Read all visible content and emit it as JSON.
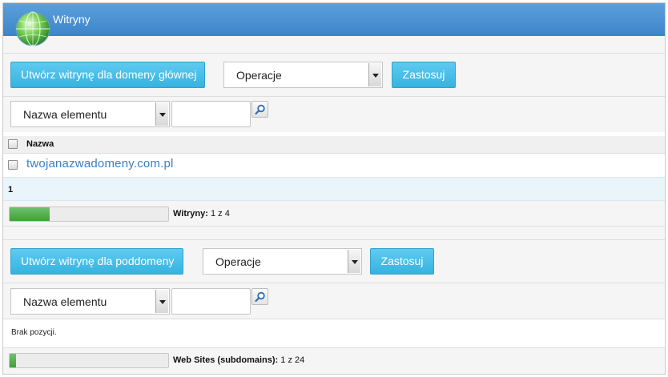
{
  "header": {
    "title": "Witryny",
    "icon": "globe-icon"
  },
  "domains_section": {
    "create_button": "Utwórz witrynę dla domeny głównej",
    "operations_select": "Operacje",
    "apply_button": "Zastosuj",
    "filter_select": "Nazwa elementu",
    "filter_value": "",
    "table": {
      "column_name": "Nazwa",
      "rows": [
        {
          "name": "twojanazwadomeny.com.pl"
        }
      ]
    },
    "pager": {
      "current_page": "1"
    },
    "usage": {
      "label": "Witryny:",
      "value": "1 z 4",
      "fraction": 0.25
    }
  },
  "subdomains_section": {
    "create_button": "Utwórz witrynę dla poddomeny",
    "operations_select": "Operacje",
    "apply_button": "Zastosuj",
    "filter_select": "Nazwa elementu",
    "filter_value": "",
    "empty_text": "Brak pozycji.",
    "usage": {
      "label": "Web Sites (subdomains):",
      "value": "1 z 24",
      "fraction": 0.042
    }
  },
  "colors": {
    "header": "#4a92d4",
    "button": "#3ab5e2",
    "link": "#3a7fc2",
    "progress": "#4caf50"
  }
}
